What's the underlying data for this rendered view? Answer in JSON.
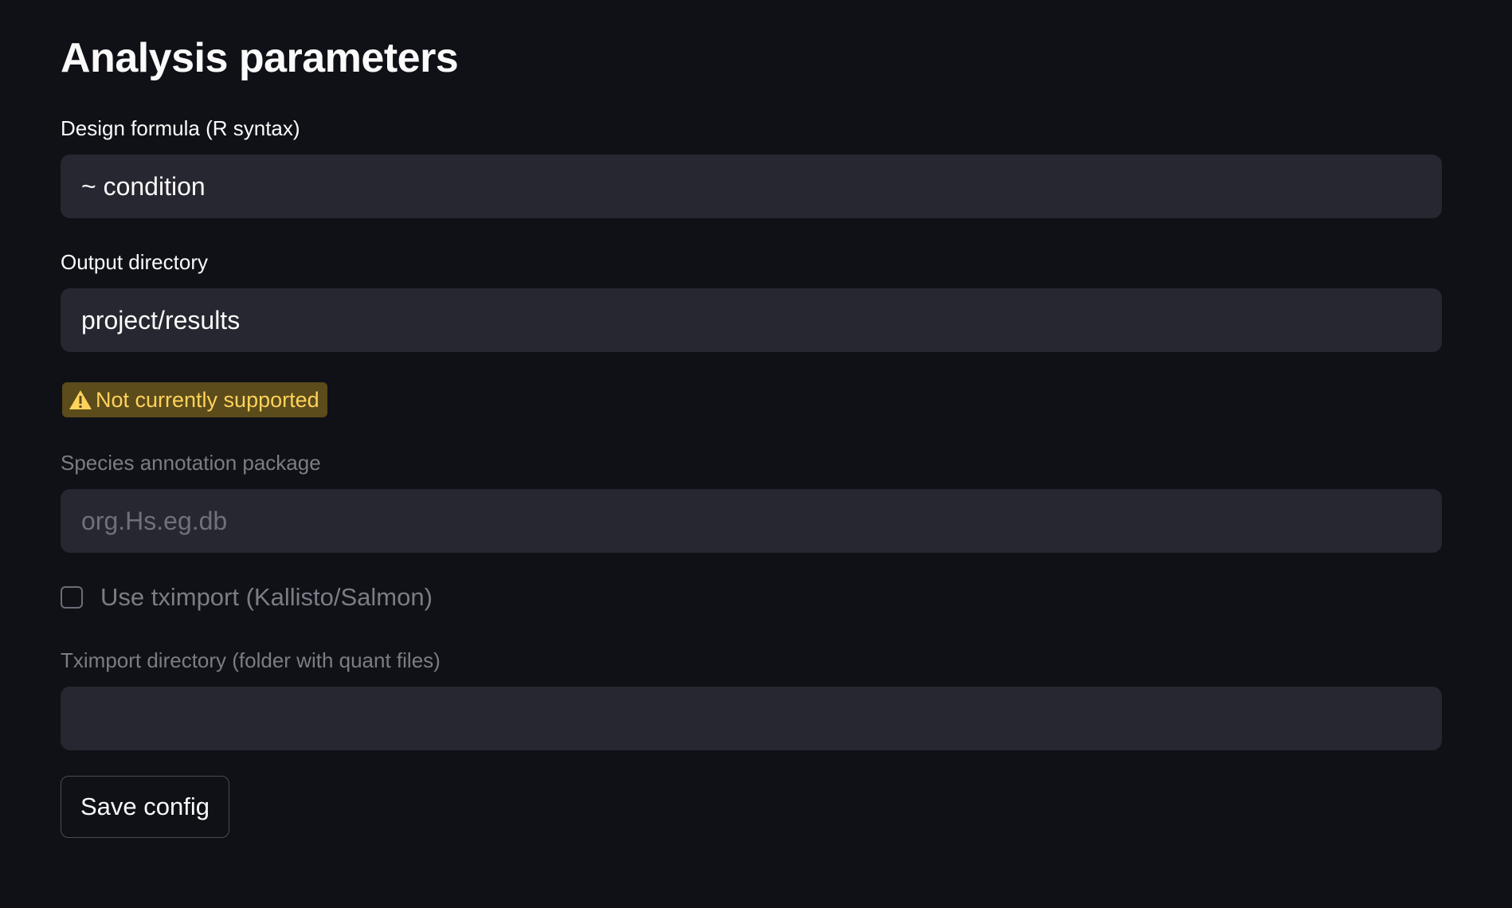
{
  "page": {
    "title": "Analysis parameters"
  },
  "design_formula": {
    "label": "Design formula (R syntax)",
    "value": "~ condition"
  },
  "output_directory": {
    "label": "Output directory",
    "value": "project/results"
  },
  "warning_badge": {
    "icon": "warning-icon",
    "text": "Not currently supported",
    "color": "#ffd35a",
    "background": "#5c4b1b"
  },
  "species_annotation": {
    "label": "Species annotation package",
    "value": "org.Hs.eg.db",
    "disabled": true
  },
  "use_tximport": {
    "label": "Use tximport (Kallisto/Salmon)",
    "checked": false,
    "disabled": true
  },
  "tximport_directory": {
    "label": "Tximport directory (folder with quant files)",
    "value": "",
    "disabled": true
  },
  "save_button": {
    "label": "Save config"
  },
  "theme": {
    "background": "#0f1117",
    "field_background": "#262730",
    "text": "#fafafa",
    "disabled_text": "#7b7d86"
  }
}
